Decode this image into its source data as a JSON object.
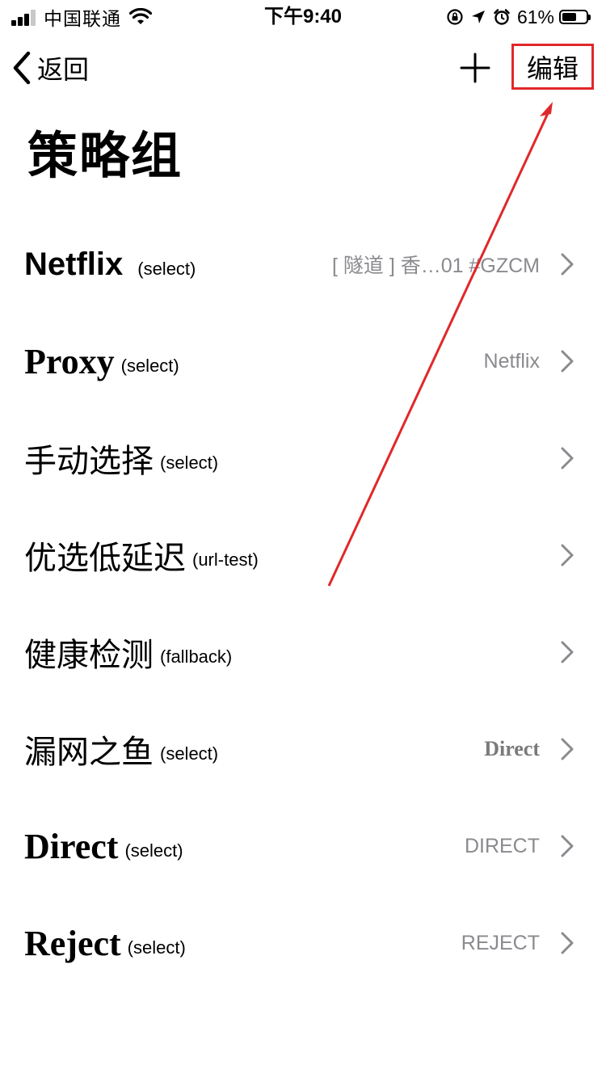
{
  "status_bar": {
    "carrier": "中国联通",
    "time": "下午9:40",
    "battery_percent_text": "61%",
    "battery_level": 0.61
  },
  "nav": {
    "back_label": "返回",
    "edit_label": "编辑",
    "accent_color": "#e0282a"
  },
  "page_title": "策略组",
  "groups": [
    {
      "name": "Netflix",
      "type": "(select)",
      "value": "[ 隧道 ] 香…01 #GZCM"
    },
    {
      "name": "Proxy",
      "type": "(select)",
      "value": "Netflix"
    },
    {
      "name": "手动选择",
      "type": "(select)",
      "value": ""
    },
    {
      "name": "优选低延迟",
      "type": "(url-test)",
      "value": ""
    },
    {
      "name": "健康检测",
      "type": "(fallback)",
      "value": ""
    },
    {
      "name": "漏网之鱼",
      "type": "(select)",
      "value": "Direct"
    },
    {
      "name": "Direct",
      "type": "(select)",
      "value": "DIRECT"
    },
    {
      "name": "Reject",
      "type": "(select)",
      "value": "REJECT"
    }
  ],
  "icons": {
    "back": "chevron-left-icon",
    "add": "plus-icon",
    "row": "chevron-right-icon",
    "wifi": "wifi-icon",
    "location": "location-arrow-icon",
    "alarm": "alarm-clock-icon",
    "rotation_lock": "rotation-lock-icon"
  }
}
